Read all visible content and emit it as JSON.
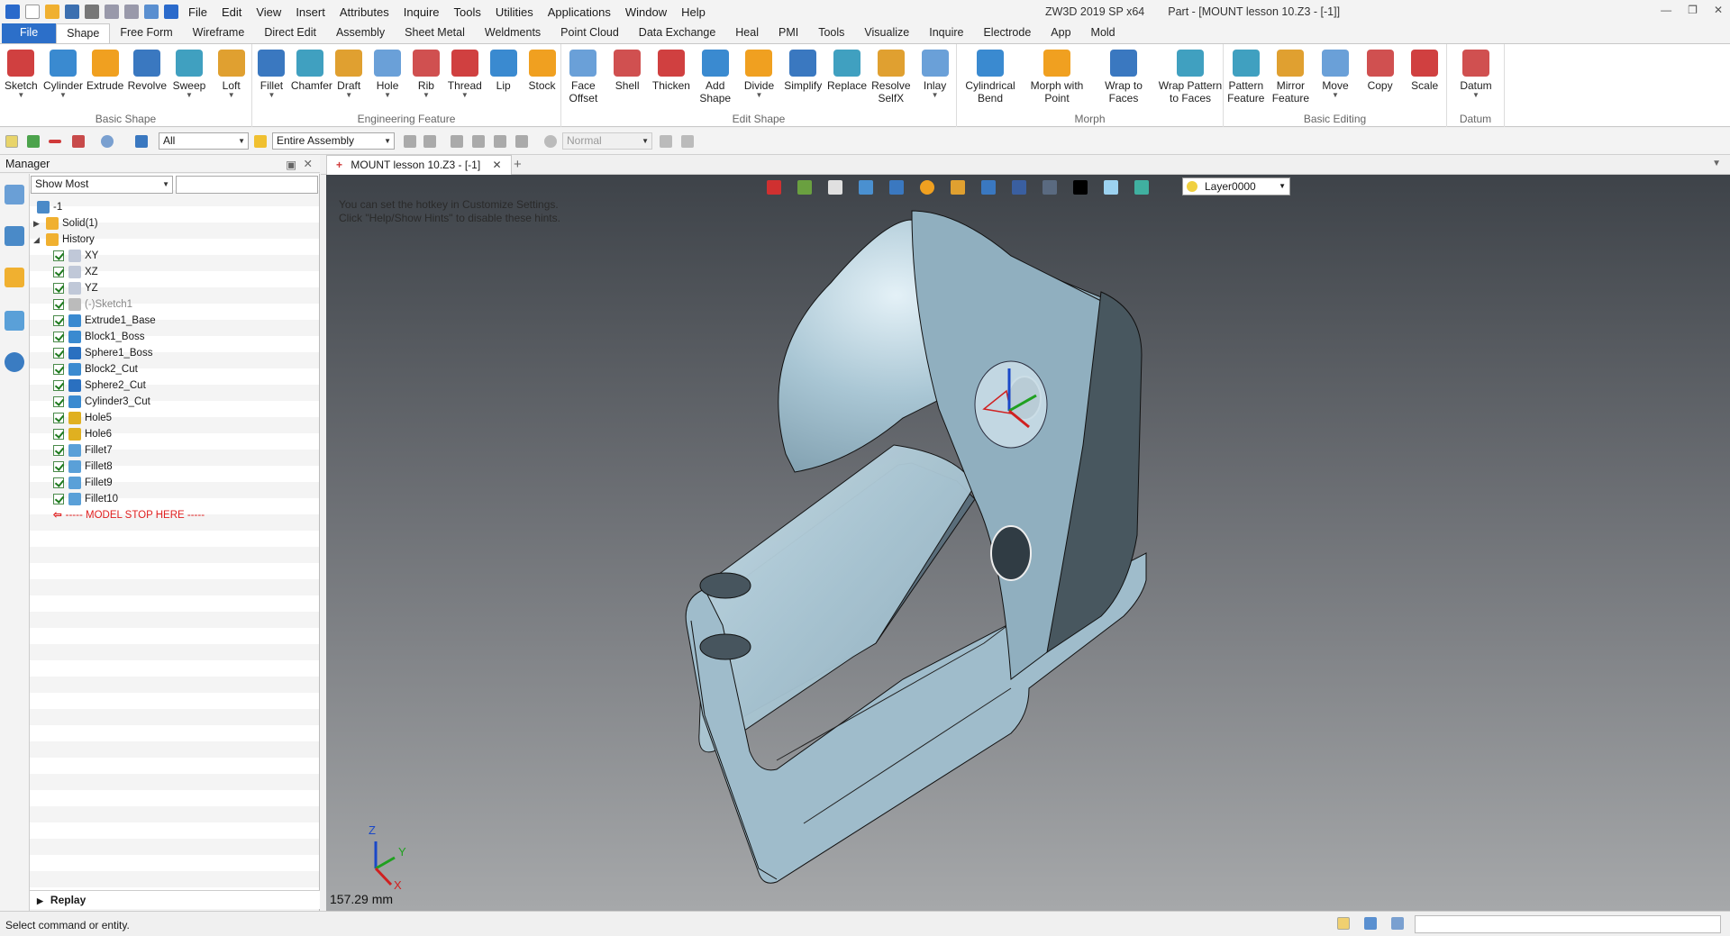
{
  "app": {
    "title": "ZW3D 2019 SP x64",
    "document": "Part - [MOUNT lesson 10.Z3 - [-1]]"
  },
  "menu": [
    "File",
    "Edit",
    "View",
    "Insert",
    "Attributes",
    "Inquire",
    "Tools",
    "Utilities",
    "Applications",
    "Window",
    "Help"
  ],
  "tabs": [
    "File",
    "Shape",
    "Free Form",
    "Wireframe",
    "Direct Edit",
    "Assembly",
    "Sheet Metal",
    "Weldments",
    "Point Cloud",
    "Data Exchange",
    "Heal",
    "PMI",
    "Tools",
    "Visualize",
    "Inquire",
    "Electrode",
    "App",
    "Mold"
  ],
  "active_tab": "Shape",
  "ribbon": {
    "groups": [
      {
        "label": "Basic Shape",
        "tools": [
          {
            "l1": "Sketch",
            "dd": true
          },
          {
            "l1": "Cylinder",
            "dd": true
          },
          {
            "l1": "Extrude"
          },
          {
            "l1": "Revolve"
          },
          {
            "l1": "Sweep",
            "dd": true
          },
          {
            "l1": "Loft",
            "dd": true
          }
        ]
      },
      {
        "label": "Engineering Feature",
        "tools": [
          {
            "l1": "Fillet",
            "dd": true
          },
          {
            "l1": "Chamfer"
          },
          {
            "l1": "Draft",
            "dd": true
          },
          {
            "l1": "Hole",
            "dd": true
          },
          {
            "l1": "Rib",
            "dd": true
          },
          {
            "l1": "Thread",
            "dd": true
          },
          {
            "l1": "Lip"
          },
          {
            "l1": "Stock"
          }
        ]
      },
      {
        "label": "Edit Shape",
        "tools": [
          {
            "l1": "Face",
            "l2": "Offset"
          },
          {
            "l1": "Shell"
          },
          {
            "l1": "Thicken"
          },
          {
            "l1": "Add",
            "l2": "Shape"
          },
          {
            "l1": "Divide",
            "dd": true
          },
          {
            "l1": "Simplify"
          },
          {
            "l1": "Replace"
          },
          {
            "l1": "Resolve",
            "l2": "SelfX"
          },
          {
            "l1": "Inlay",
            "dd": true
          }
        ]
      },
      {
        "label": "Morph",
        "tools": [
          {
            "l1": "Cylindrical",
            "l2": "Bend"
          },
          {
            "l1": "Morph with",
            "l2": "Point"
          },
          {
            "l1": "Wrap to",
            "l2": "Faces"
          },
          {
            "l1": "Wrap Pattern",
            "l2": "to Faces"
          }
        ]
      },
      {
        "label": "Basic Editing",
        "tools": [
          {
            "l1": "Pattern",
            "l2": "Feature"
          },
          {
            "l1": "Mirror",
            "l2": "Feature"
          },
          {
            "l1": "Move",
            "dd": true
          },
          {
            "l1": "Copy"
          },
          {
            "l1": "Scale"
          }
        ]
      },
      {
        "label": "Datum",
        "tools": [
          {
            "l1": "Datum",
            "dd": true
          }
        ]
      }
    ]
  },
  "toolbar": {
    "filter": "All",
    "scope": "Entire Assembly",
    "render": "Normal"
  },
  "manager": {
    "title": "Manager",
    "filter": "Show Most",
    "tree": [
      {
        "text": "-1",
        "level": 0,
        "type": "root"
      },
      {
        "text": "Solid(1)",
        "level": 1,
        "type": "folder",
        "expander": "▶"
      },
      {
        "text": "History",
        "level": 1,
        "type": "folder",
        "expander": "◢"
      },
      {
        "text": "XY",
        "level": 2,
        "type": "plane",
        "check": true
      },
      {
        "text": "XZ",
        "level": 2,
        "type": "plane",
        "check": true
      },
      {
        "text": "YZ",
        "level": 2,
        "type": "plane",
        "check": true
      },
      {
        "text": "(-)Sketch1",
        "level": 2,
        "type": "sketch",
        "check": true,
        "dim": true
      },
      {
        "text": "Extrude1_Base",
        "level": 2,
        "type": "feature",
        "check": true
      },
      {
        "text": "Block1_Boss",
        "level": 2,
        "type": "feature",
        "check": true
      },
      {
        "text": "Sphere1_Boss",
        "level": 2,
        "type": "sphere",
        "check": true
      },
      {
        "text": "Block2_Cut",
        "level": 2,
        "type": "feature",
        "check": true
      },
      {
        "text": "Sphere2_Cut",
        "level": 2,
        "type": "sphere",
        "check": true
      },
      {
        "text": "Cylinder3_Cut",
        "level": 2,
        "type": "cyl",
        "check": true
      },
      {
        "text": "Hole5",
        "level": 2,
        "type": "hole",
        "check": true
      },
      {
        "text": "Hole6",
        "level": 2,
        "type": "hole",
        "check": true
      },
      {
        "text": "Fillet7",
        "level": 2,
        "type": "fillet",
        "check": true
      },
      {
        "text": "Fillet8",
        "level": 2,
        "type": "fillet",
        "check": true
      },
      {
        "text": "Fillet9",
        "level": 2,
        "type": "fillet",
        "check": true
      },
      {
        "text": "Fillet10",
        "level": 2,
        "type": "fillet",
        "check": true
      },
      {
        "text": "----- MODEL STOP HERE -----",
        "level": 2,
        "type": "stop"
      }
    ],
    "replay": "Replay"
  },
  "doc_tab": "MOUNT lesson 10.Z3 - [-1]",
  "viewport": {
    "hint1": "You can set the hotkey in Customize Settings.",
    "hint2": "Click \"Help/Show Hints\" to disable these hints.",
    "layer": "Layer0000",
    "dimension": "157.29 mm",
    "axis": {
      "x": "X",
      "y": "Y",
      "z": "Z"
    }
  },
  "status": {
    "text": "Select command or entity."
  },
  "colors": {
    "file_tab": "#2c6fc9",
    "stop": "#e02020",
    "part": "#a9c6d4"
  }
}
